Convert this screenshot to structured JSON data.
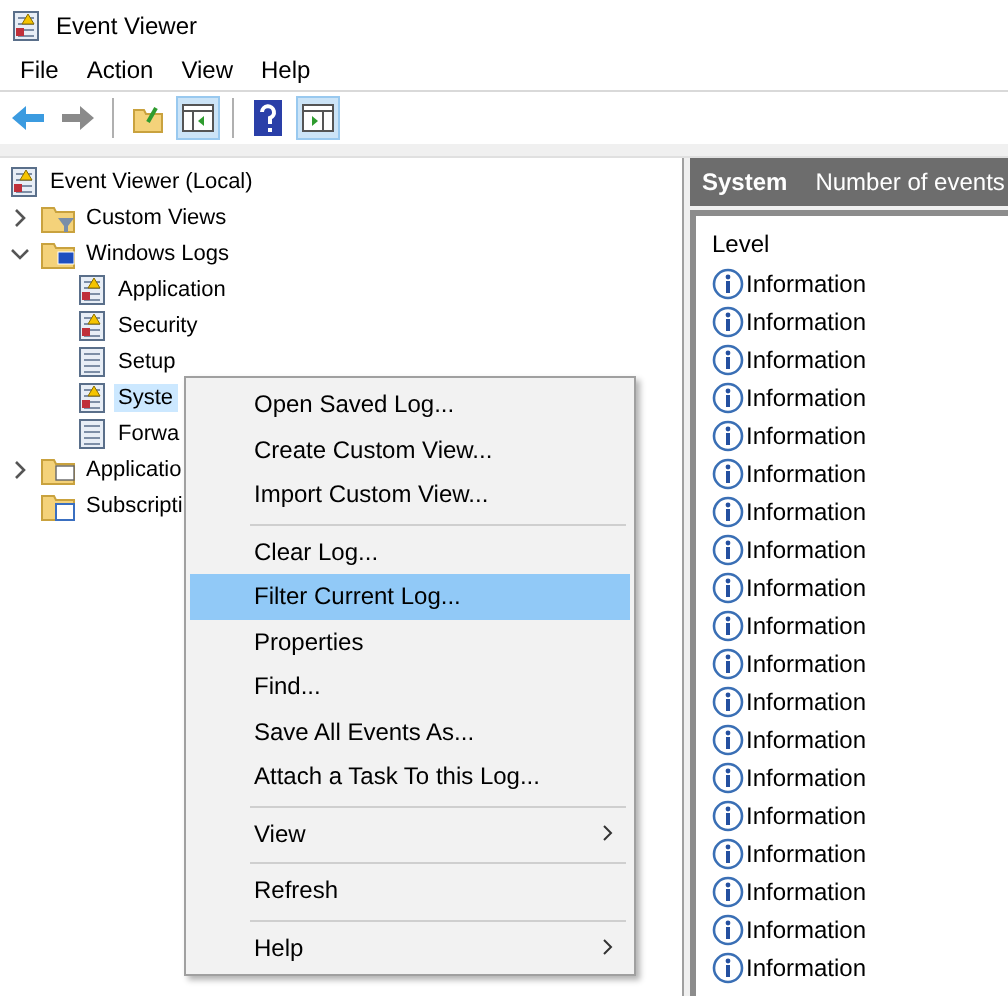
{
  "window": {
    "title": "Event Viewer"
  },
  "menu_bar": [
    "File",
    "Action",
    "View",
    "Help"
  ],
  "toolbar": [
    {
      "kind": "back",
      "selected": false
    },
    {
      "kind": "forward",
      "selected": false
    },
    {
      "kind": "divider"
    },
    {
      "kind": "folder",
      "selected": false
    },
    {
      "kind": "pane",
      "selected": true
    },
    {
      "kind": "divider"
    },
    {
      "kind": "help",
      "selected": false
    },
    {
      "kind": "pane2",
      "selected": true
    }
  ],
  "tree": {
    "label": "Event Viewer (Local)",
    "kind": "log",
    "children": [
      {
        "label": "Custom Views",
        "kind": "filterfolder",
        "expanded": false,
        "selected": false
      },
      {
        "label": "Windows Logs",
        "kind": "pcfolder",
        "expanded": true,
        "selected": false,
        "children": [
          {
            "label": "Application",
            "kind": "log",
            "selected": false
          },
          {
            "label": "Security",
            "kind": "log",
            "selected": false
          },
          {
            "label": "Setup",
            "kind": "plainlog",
            "selected": false
          },
          {
            "label": "Syste",
            "kind": "log",
            "selected": true
          },
          {
            "label": "Forwa",
            "kind": "plainlog",
            "selected": false
          }
        ]
      },
      {
        "label": "Applicatio",
        "kind": "folder",
        "expanded": false,
        "selected": false
      },
      {
        "label": "Subscripti",
        "kind": "subfolder",
        "selected": false
      }
    ]
  },
  "panel": {
    "title": "System",
    "subtitle": "Number of events",
    "column": "Level",
    "rows": [
      "Information",
      "Information",
      "Information",
      "Information",
      "Information",
      "Information",
      "Information",
      "Information",
      "Information",
      "Information",
      "Information",
      "Information",
      "Information",
      "Information",
      "Information",
      "Information",
      "Information",
      "Information",
      "Information"
    ]
  },
  "context_menu": [
    {
      "kind": "item",
      "label": "Open Saved Log...",
      "selected": false,
      "submenu": false
    },
    {
      "kind": "item",
      "label": "Create Custom View...",
      "selected": false,
      "submenu": false
    },
    {
      "kind": "item",
      "label": "Import Custom View...",
      "selected": false,
      "submenu": false
    },
    {
      "kind": "separator"
    },
    {
      "kind": "item",
      "label": "Clear Log...",
      "selected": false,
      "submenu": false
    },
    {
      "kind": "item",
      "label": "Filter Current Log...",
      "selected": true,
      "submenu": false
    },
    {
      "kind": "item",
      "label": "Properties",
      "selected": false,
      "submenu": false
    },
    {
      "kind": "item",
      "label": "Find...",
      "selected": false,
      "submenu": false
    },
    {
      "kind": "item",
      "label": "Save All Events As...",
      "selected": false,
      "submenu": false
    },
    {
      "kind": "item",
      "label": "Attach a Task To this Log...",
      "selected": false,
      "submenu": false
    },
    {
      "kind": "separator"
    },
    {
      "kind": "item",
      "label": "View",
      "selected": false,
      "submenu": true
    },
    {
      "kind": "separator"
    },
    {
      "kind": "item",
      "label": "Refresh",
      "selected": false,
      "submenu": false
    },
    {
      "kind": "separator"
    },
    {
      "kind": "item",
      "label": "Help",
      "selected": false,
      "submenu": true
    }
  ]
}
